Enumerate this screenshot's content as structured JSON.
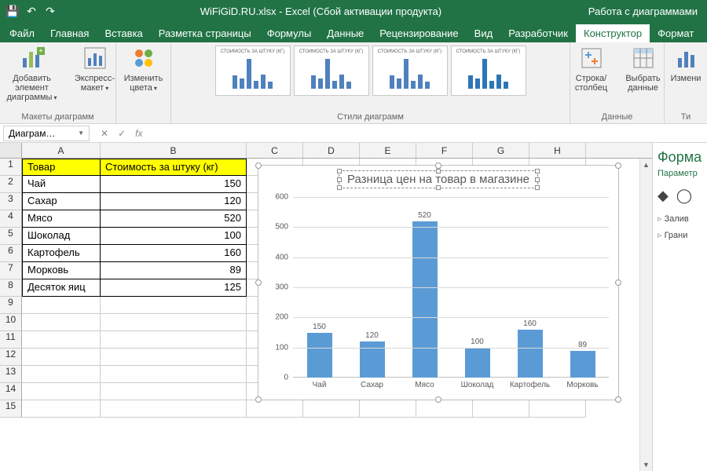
{
  "titlebar": {
    "filename": "WiFiGiD.RU.xlsx - Excel (Сбой активации продукта)",
    "context_tab": "Работа с диаграммами"
  },
  "tabs": [
    "Файл",
    "Главная",
    "Вставка",
    "Разметка страницы",
    "Формулы",
    "Данные",
    "Рецензирование",
    "Вид",
    "Разработчик",
    "Конструктор",
    "Формат"
  ],
  "active_tab": "Конструктор",
  "ribbon": {
    "g1": {
      "btn1": "Добавить элемент диаграммы",
      "btn2": "Экспресс-макет",
      "label": "Макеты диаграмм"
    },
    "g2": {
      "btn": "Изменить цвета"
    },
    "g3": {
      "label": "Стили диаграмм",
      "thumb_title": "СТОИМОСТЬ ЗА ШТУКУ (КГ)"
    },
    "g4": {
      "btn1": "Строка/столбец",
      "btn2": "Выбрать данные",
      "label": "Данные"
    },
    "g5": {
      "btn": "Измени",
      "label": "Ти"
    }
  },
  "namebox": "Диаграм…",
  "chart_data": {
    "type": "bar",
    "title": "Разница цен на товар в магазине",
    "categories": [
      "Чай",
      "Сахар",
      "Мясо",
      "Шоколад",
      "Картофель",
      "Морковь"
    ],
    "values": [
      150,
      120,
      520,
      100,
      160,
      89
    ],
    "ylim": [
      0,
      600
    ],
    "ticks": [
      0,
      100,
      200,
      300,
      400,
      500,
      600
    ],
    "xlabel": "",
    "ylabel": ""
  },
  "sheet": {
    "headers": {
      "A": "Товар",
      "B": "Стоимость за штуку (кг)"
    },
    "rows": [
      {
        "A": "Чай",
        "B": "150"
      },
      {
        "A": "Сахар",
        "B": "120"
      },
      {
        "A": "Мясо",
        "B": "520"
      },
      {
        "A": "Шоколад",
        "B": "100"
      },
      {
        "A": "Картофель",
        "B": "160"
      },
      {
        "A": "Морковь",
        "B": "89"
      },
      {
        "A": "Десяток яиц",
        "B": "125"
      }
    ],
    "cols": [
      "A",
      "B",
      "C",
      "D",
      "E",
      "F",
      "G",
      "H"
    ]
  },
  "taskpane": {
    "title": "Форма",
    "sub": "Параметр",
    "items": [
      "Залив",
      "Грани"
    ]
  }
}
